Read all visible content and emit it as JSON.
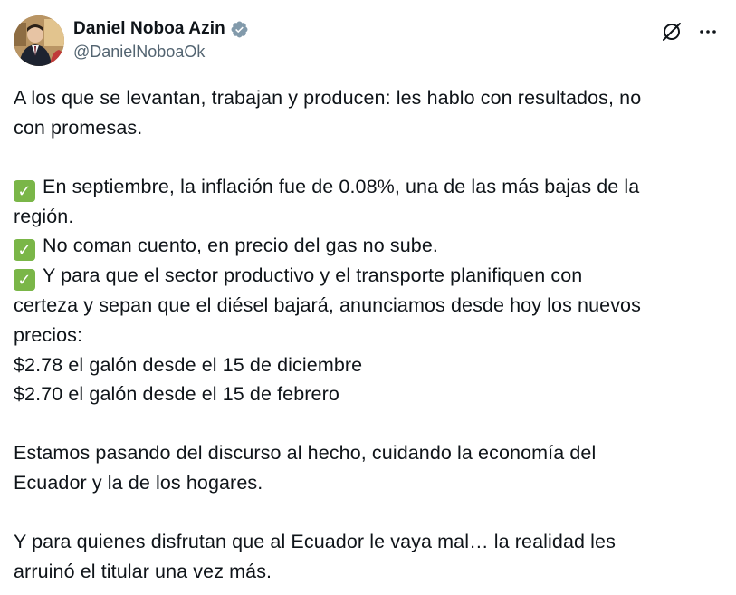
{
  "author": {
    "display_name": "Daniel Noboa Azin",
    "handle": "@DanielNoboaOk",
    "verified": true,
    "avatar_icon": "profile-photo"
  },
  "header_actions": {
    "grok_icon": "grok-icon",
    "more_icon": "more-icon",
    "more_glyph": "···"
  },
  "tweet_body": {
    "p1_line1": "A los que se levantan, trabajan y producen: les hablo con resultados, no",
    "p1_line2": "con promesas.",
    "check_glyph": "✓",
    "b1_line1": "En septiembre, la inflación fue de 0.08%, una de las más bajas de la",
    "b1_line2": "región.",
    "b2_line1": "No coman cuento, en precio del gas no sube.",
    "b3_line1": "Y para que el sector productivo y el transporte planifiquen con",
    "b3_line2": "certeza y sepan que el diésel bajará, anunciamos desde hoy los nuevos",
    "b3_line3": "precios:",
    "price1": "$2.78 el galón desde el 15 de diciembre",
    "price2": "$2.70 el galón desde el 15 de febrero",
    "p3_line1": "Estamos pasando del discurso al hecho, cuidando la economía del",
    "p3_line2": "Ecuador y la de los hogares.",
    "p4_line1": "Y para quienes disfrutan que al Ecuador le vaya mal… la realidad les",
    "p4_line2": "arruinó el titular una vez más."
  },
  "colors": {
    "text": "#0f1419",
    "secondary": "#536471",
    "verified_badge": "#829aab",
    "check_green": "#7ab648"
  }
}
